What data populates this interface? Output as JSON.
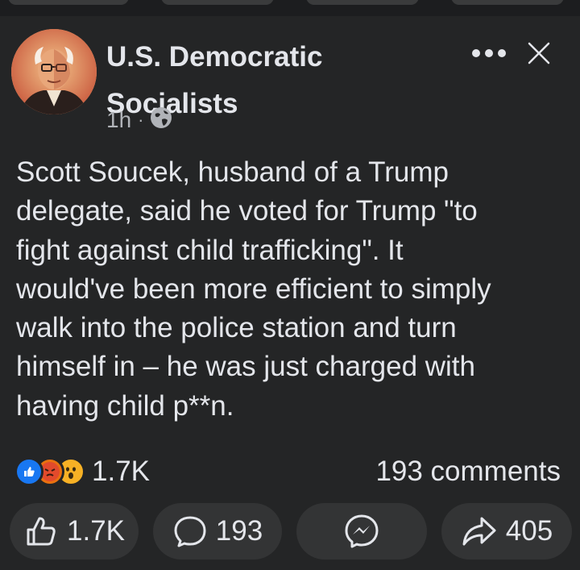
{
  "post": {
    "page_name": "U.S. Democratic Socialists",
    "time": "1h",
    "separator": "·",
    "audience_icon": "globe-icon",
    "text": "Scott Soucek, husband of a Trump\ndelegate, said he voted for Trump \"to\nfight against child trafficking\". It\nwould've been more efficient to simply\nwalk into the police station and turn\nhimself in – he was just charged with\nhaving child p**n."
  },
  "stats": {
    "reactions": [
      "like-icon",
      "angry-icon",
      "wow-icon"
    ],
    "reaction_count": "1.7K",
    "comments": "193 comments"
  },
  "actions": {
    "like": "1.7K",
    "comment": "193",
    "share": "405"
  },
  "colors": {
    "background": "#242526",
    "text": "#e4e6eb",
    "secondary_text": "#b0b3b8",
    "button": "#333435",
    "like_blue": "#1877f2",
    "angry_orange": "#e9710f"
  }
}
